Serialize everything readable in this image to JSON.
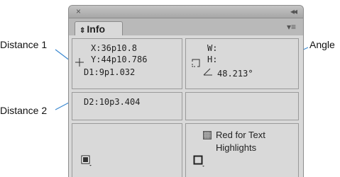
{
  "callouts": {
    "distance1": "Distance 1",
    "distance2": "Distance 2",
    "angle": "Angle"
  },
  "panel": {
    "close_glyph": "×",
    "collapse_glyph": "◂◂",
    "tab_label": "Info",
    "tab_chevron": "⇕",
    "menu_glyph": "▾≡"
  },
  "info": {
    "x_label": "X:",
    "x_value": "36p10.8",
    "y_label": "Y:",
    "y_value": "44p10.786",
    "d1_label": "D1:",
    "d1_value": "9p1.032",
    "w_label": "W:",
    "h_label": "H:",
    "angle_value": "48.213°",
    "d2_label": "D2:",
    "d2_value": "10p3.404",
    "red_text_line1": "Red for Text",
    "red_text_line2": "Highlights"
  }
}
